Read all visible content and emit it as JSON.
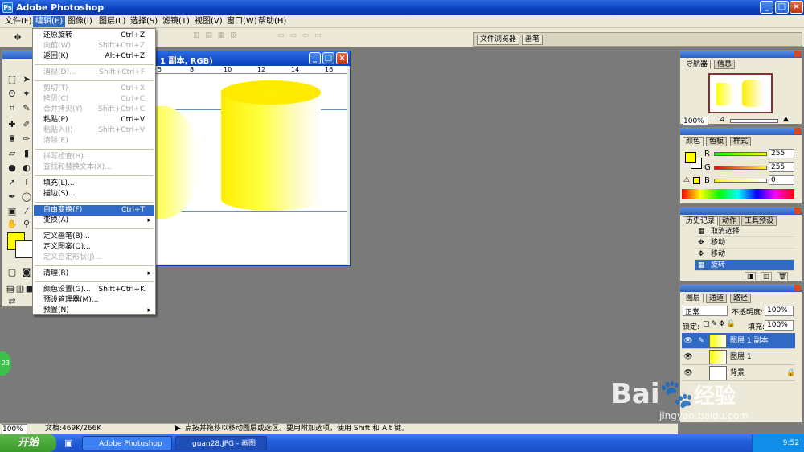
{
  "app": {
    "title": "Adobe Photoshop"
  },
  "menubar": [
    "文件(F)",
    "编辑(E)",
    "图像(I)",
    "图层(L)",
    "选择(S)",
    "滤镜(T)",
    "视图(V)",
    "窗口(W)",
    "帮助(H)"
  ],
  "palette_well": {
    "tab1": "文件浏览器",
    "tab2": "画笔"
  },
  "document": {
    "title": "1 副本, RGB)",
    "ruler": [
      "5",
      "8",
      "10",
      "12",
      "14",
      "16"
    ]
  },
  "edit_menu": [
    {
      "label": "还原旋转",
      "key": "Ctrl+Z",
      "state": "enabled"
    },
    {
      "label": "向前(W)",
      "key": "Shift+Ctrl+Z",
      "state": "disabled"
    },
    {
      "label": "返回(K)",
      "key": "Alt+Ctrl+Z",
      "state": "enabled"
    },
    {
      "label": "消褪(D)...",
      "key": "Shift+Ctrl+F",
      "state": "disabled"
    },
    {
      "label": "剪切(T)",
      "key": "Ctrl+X",
      "state": "disabled"
    },
    {
      "label": "拷贝(C)",
      "key": "Ctrl+C",
      "state": "disabled"
    },
    {
      "label": "合并拷贝(Y)",
      "key": "Shift+Ctrl+C",
      "state": "disabled"
    },
    {
      "label": "粘贴(P)",
      "key": "Ctrl+V",
      "state": "enabled"
    },
    {
      "label": "粘贴入(I)",
      "key": "Shift+Ctrl+V",
      "state": "disabled"
    },
    {
      "label": "清除(E)",
      "key": "",
      "state": "disabled"
    },
    {
      "label": "拼写检查(H)...",
      "key": "",
      "state": "disabled"
    },
    {
      "label": "查找和替换文本(X)...",
      "key": "",
      "state": "disabled"
    },
    {
      "label": "填充(L)...",
      "key": "",
      "state": "enabled"
    },
    {
      "label": "描边(S)...",
      "key": "",
      "state": "enabled"
    },
    {
      "label": "自由变换(F)",
      "key": "Ctrl+T",
      "state": "highlighted"
    },
    {
      "label": "变换(A)",
      "key": "",
      "state": "submenu"
    },
    {
      "label": "定义画笔(B)...",
      "key": "",
      "state": "enabled"
    },
    {
      "label": "定义图案(Q)...",
      "key": "",
      "state": "enabled"
    },
    {
      "label": "定义自定形状(J)...",
      "key": "",
      "state": "disabled"
    },
    {
      "label": "清理(R)",
      "key": "",
      "state": "submenu"
    },
    {
      "label": "颜色设置(G)...",
      "key": "Shift+Ctrl+K",
      "state": "enabled"
    },
    {
      "label": "预设管理器(M)...",
      "key": "",
      "state": "enabled"
    },
    {
      "label": "预置(N)",
      "key": "",
      "state": "submenu"
    }
  ],
  "navigator": {
    "tab1": "导航器",
    "tab2": "信息",
    "zoom": "100%"
  },
  "color_panel": {
    "tab1": "颜色",
    "tab2": "色板",
    "tab3": "样式",
    "r_label": "R",
    "g_label": "G",
    "b_label": "B",
    "r": "255",
    "g": "255",
    "b": "0"
  },
  "history": {
    "tab1": "历史记录",
    "tab2": "动作",
    "tab3": "工具预设",
    "items": [
      "取消选择",
      "移动",
      "移动",
      "旋转"
    ]
  },
  "layers": {
    "tab1": "图层",
    "tab2": "通道",
    "tab3": "路径",
    "blend_mode": "正常",
    "opacity_label": "不透明度:",
    "opacity": "100%",
    "lock_label": "锁定:",
    "fill_label": "填充:",
    "fill": "100%",
    "items": [
      "图层 1 副本",
      "图层 1",
      "背景"
    ]
  },
  "status": {
    "zoom": "100%",
    "doc": "文档:469K/266K",
    "hint": "点按并拖移以移动图层或选区。要用附加选项，使用 Shift 和 Alt 键。"
  },
  "taskbar": {
    "start": "开始",
    "task1": "Adobe Photoshop",
    "task2": "guan28.JPG - 画图",
    "time": "9:52"
  },
  "watermark": {
    "brand": "Bai",
    "brand2": "经验",
    "url": "jingyan.baidu.com"
  },
  "side_badge": "23",
  "colors": {
    "accent": "#316ac5",
    "fg_color": "#ffff00",
    "titlebar": "#0a3fbd"
  }
}
